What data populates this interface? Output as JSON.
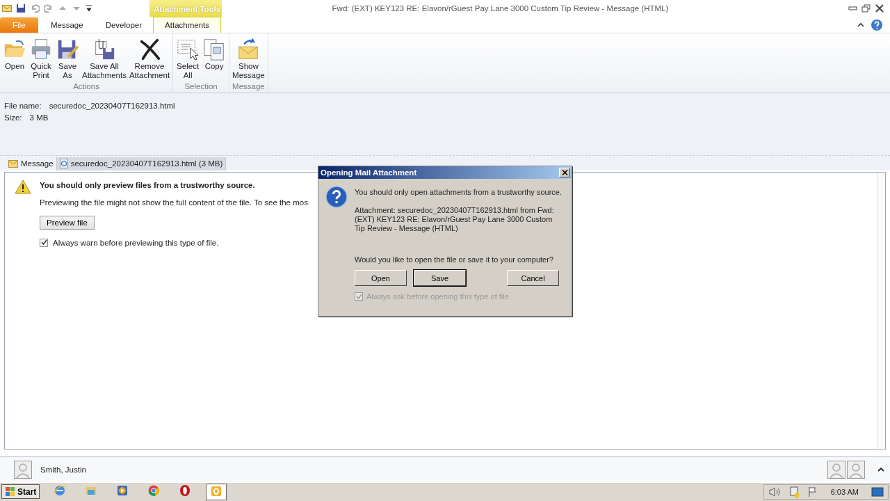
{
  "window": {
    "title": "Fwd: (EXT) KEY123 RE: Elavon/rGuest Pay Lane 3000 Custom Tip Review  -  Message (HTML)",
    "context_tab_label": "Attachment Tools"
  },
  "tabs": [
    {
      "label": "File",
      "kind": "file",
      "selected": false
    },
    {
      "label": "Message",
      "kind": "normal",
      "selected": false
    },
    {
      "label": "Developer",
      "kind": "normal",
      "selected": false
    },
    {
      "label": "Attachments",
      "kind": "contextual",
      "selected": true
    }
  ],
  "ribbon": {
    "groups": [
      {
        "label": "Actions",
        "buttons": [
          "Open",
          "Quick\nPrint",
          "Save\nAs",
          "Save All\nAttachments",
          "Remove\nAttachment"
        ]
      },
      {
        "label": "Selection",
        "buttons": [
          "Select\nAll",
          "Copy"
        ]
      },
      {
        "label": "Message",
        "buttons": [
          "Show\nMessage"
        ]
      }
    ]
  },
  "info": {
    "file_name_label": "File name:",
    "file_name": "securedoc_20230407T162913.html",
    "size_label": "Size:",
    "size": "3 MB"
  },
  "attachment_tabs": [
    {
      "label": "Message",
      "kind": "message",
      "selected": false
    },
    {
      "label": "securedoc_20230407T162913.html (3 MB)",
      "kind": "file",
      "selected": true
    }
  ],
  "preview_notice": {
    "heading": "You should only preview files from a trustworthy source.",
    "body": "Previewing the file might not show the full content of the file. To see the mos",
    "button": "Preview file",
    "checkbox": {
      "label": "Always warn before previewing this type of file.",
      "checked": true
    }
  },
  "dialog": {
    "title": "Opening Mail Attachment",
    "message": "You should only open attachments from a trustworthy source.",
    "detail": "Attachment: securedoc_20230407T162913.html from Fwd: (EXT) KEY123 RE: Elavon/rGuest Pay Lane 3000 Custom Tip Review - Message (HTML)",
    "question": "Would you like to open the file or save it to your computer?",
    "buttons": [
      {
        "label": "Open",
        "default": false
      },
      {
        "label": "Save",
        "default": true
      },
      {
        "label": "Cancel",
        "default": false
      }
    ],
    "checkbox": {
      "label": "Always ask before opening this type of file",
      "checked": true,
      "disabled": true
    }
  },
  "people_pane": {
    "name": "Smith, Justin"
  },
  "taskbar": {
    "start": "Start",
    "apps": [
      {
        "kind": "ie",
        "active": false
      },
      {
        "kind": "explorer",
        "active": false
      },
      {
        "kind": "media",
        "active": false
      },
      {
        "kind": "chrome",
        "active": false
      },
      {
        "kind": "opera",
        "active": false
      },
      {
        "kind": "outlook",
        "active": true
      }
    ],
    "clock": "6:03 AM"
  }
}
